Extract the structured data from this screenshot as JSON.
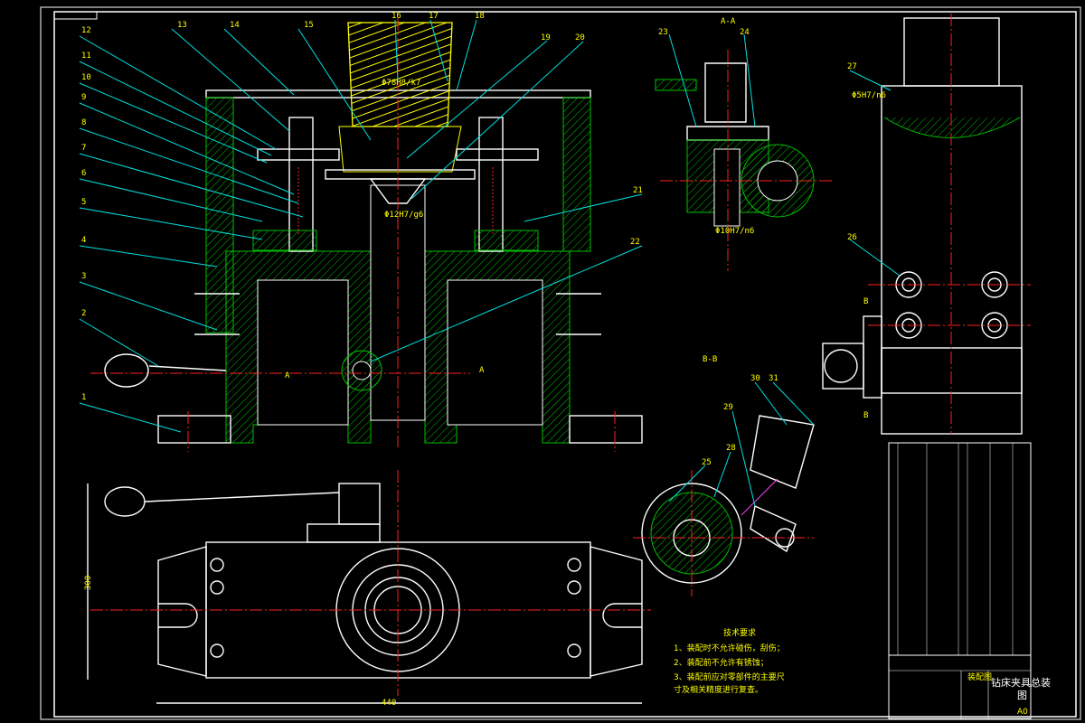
{
  "section_labels": {
    "aa": "A-A",
    "bb": "B-B",
    "a_left": "A",
    "a_right": "A",
    "b_top": "B",
    "b_bottom": "B"
  },
  "part_numbers_left": [
    "12",
    "11",
    "10",
    "9",
    "8",
    "7",
    "6",
    "5",
    "4",
    "3",
    "2",
    "1"
  ],
  "part_numbers_top": [
    "13",
    "14",
    "15",
    "16",
    "17",
    "18",
    "19",
    "20"
  ],
  "part_numbers_right": [
    "21",
    "22"
  ],
  "part_numbers_aa": [
    "23",
    "24"
  ],
  "part_numbers_side": [
    "27",
    "26"
  ],
  "part_numbers_bb": [
    "28",
    "29",
    "30",
    "31",
    "25"
  ],
  "fits": {
    "top_fit": "Φ78H8/k7",
    "mid_fit": "Φ12H7/g6",
    "aa_fit": "Φ10H7/n6",
    "side_fit": "Φ5H7/n6"
  },
  "dims": {
    "width": "440",
    "height": "300"
  },
  "tech_req": {
    "title": "技术要求",
    "lines": [
      "1、装配时不允许碰伤，刮伤；",
      "2、装配前不允许有锈蚀；",
      "3、装配前应对零部件的主要尺",
      "寸及相关精度进行复查。"
    ]
  },
  "title_block": {
    "drawing_title": "钻床夹具总装",
    "drawing_title_2": "图",
    "sheet_code": "A0",
    "assembly_label": "装配图"
  },
  "colors": {
    "background": "#000000",
    "outline": "#ffffff",
    "leader": "#00e0e0",
    "centerline": "#ff2020",
    "hatch": "#00c000",
    "text": "#ffff00"
  }
}
